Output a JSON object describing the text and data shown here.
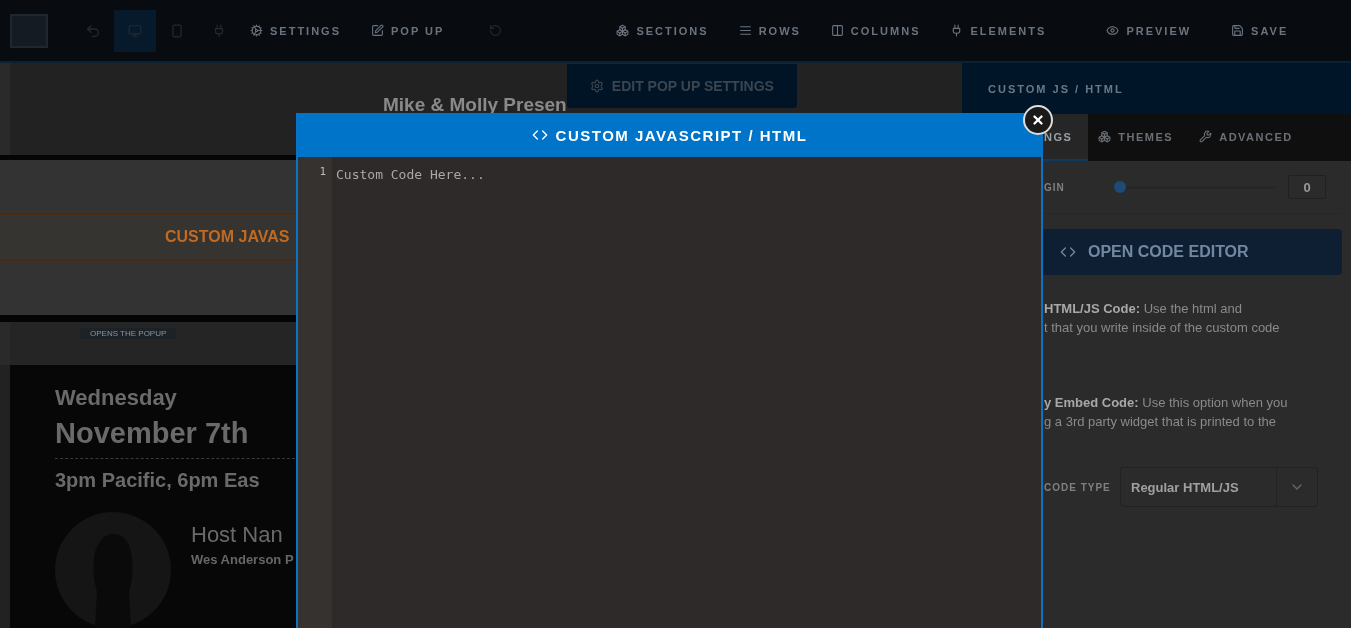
{
  "toolbar": {
    "devices": [
      {
        "selected": true
      },
      {
        "selected": false
      }
    ],
    "left_buttons": [
      {
        "label": "SETTINGS"
      },
      {
        "label": "POP UP"
      }
    ],
    "right_buttons": [
      {
        "label": "SECTIONS"
      },
      {
        "label": "ROWS"
      },
      {
        "label": "COLUMNS"
      },
      {
        "label": "ELEMENTS"
      },
      {
        "label": "PREVIEW"
      },
      {
        "label": "SAVE"
      }
    ]
  },
  "canvas": {
    "headline": "Mike & Molly Presen",
    "edit_button": "EDIT POP UP SETTINGS",
    "banner": "CUSTOM JAVAS",
    "tag": "OPENS THE POPUP",
    "event": {
      "day": "Wednesday",
      "date": "November 7th",
      "time": "3pm Pacific, 6pm Eas",
      "host_title": "Host Nan",
      "host_line": "Wes Anderson P"
    }
  },
  "panel": {
    "title": "CUSTOM JS / HTML",
    "tabs": [
      {
        "label": "NGS",
        "selected": true
      },
      {
        "label": "THEMES",
        "selected": false
      },
      {
        "label": "ADVANCED",
        "selected": false
      }
    ],
    "margin": {
      "label": "GIN",
      "level": 0,
      "value": "0"
    },
    "open_button": "OPEN CODE EDITOR",
    "paragraphs": [
      [
        "**HTML/JS Code:** Use the html and",
        "t that you write inside of the custom code"
      ],
      [
        "**y Embed Code:** Use this option when you",
        "g a 3rd party widget that is printed to the"
      ]
    ],
    "code_type": {
      "label": "CODE TYPE",
      "value": "Regular HTML/JS"
    }
  },
  "modal": {
    "title": "CUSTOM JAVASCRIPT / HTML",
    "line_number": "1",
    "placeholder": "Custom Code Here..."
  }
}
